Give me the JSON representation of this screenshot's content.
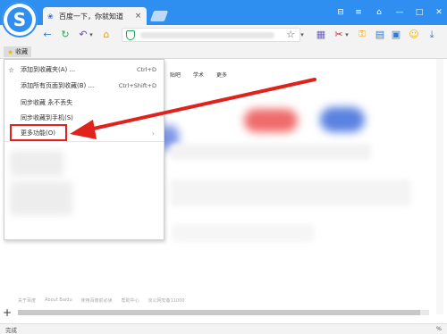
{
  "titlebar": {
    "tab_title": "百度一下，你就知道",
    "tab_icon": "paw-icon",
    "close_glyph": "×",
    "controls": [
      "⊟",
      "≡",
      "⌂",
      "—",
      "□",
      "✕"
    ]
  },
  "toolbar": {
    "back": "←",
    "refresh": "↻",
    "undo": "↶",
    "home": "⌂",
    "star": "☆",
    "dropdown": "▾",
    "scissors": "✂",
    "key": "🔑",
    "download": "⤓"
  },
  "bookmarks_bar": {
    "favorites_label": "收藏"
  },
  "page": {
    "nav_items": [
      "贴吧",
      "学术",
      "更多"
    ],
    "footer_links": [
      "关于百度",
      "About Baidu",
      "使用百度前必读",
      "帮助中心",
      "京公网安备11000"
    ]
  },
  "menu": {
    "items": [
      {
        "icon": "☆",
        "label": "添加到收藏夹(A) ...",
        "shortcut": "Ctrl+D"
      },
      {
        "icon": "",
        "label": "添加所有页面到收藏(B) ...",
        "shortcut": "Ctrl+Shift+D"
      },
      {
        "icon": "",
        "label": "同步收藏 永不丢失",
        "shortcut": ""
      },
      {
        "icon": "",
        "label": "同步收藏到手机(S)",
        "shortcut": ""
      },
      {
        "icon": "",
        "label": "更多功能(O)",
        "shortcut": "",
        "submenu_arrow": "›"
      }
    ]
  },
  "status_bar": {
    "left_text": "完成",
    "right_text": "%"
  },
  "colors": {
    "titlebar": "#2f8ff0",
    "highlight_box": "#e0221c",
    "arrow": "#e0221c"
  }
}
